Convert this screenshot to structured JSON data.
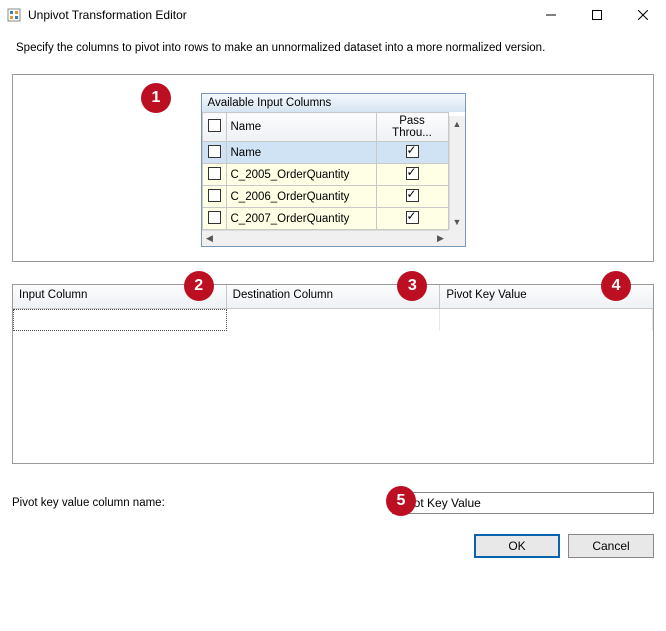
{
  "window": {
    "title": "Unpivot Transformation Editor",
    "subtitle": "Specify the columns to pivot into rows to make an unnormalized dataset into a more normalized version."
  },
  "input_columns": {
    "title": "Available Input Columns",
    "headers": {
      "name": "Name",
      "pass_through": "Pass Throu..."
    },
    "rows": [
      {
        "name": "Name",
        "selected": false,
        "pass_through": true,
        "highlighted": true
      },
      {
        "name": "C_2005_OrderQuantity",
        "selected": false,
        "pass_through": true,
        "highlighted": false
      },
      {
        "name": "C_2006_OrderQuantity",
        "selected": false,
        "pass_through": true,
        "highlighted": false
      },
      {
        "name": "C_2007_OrderQuantity",
        "selected": false,
        "pass_through": true,
        "highlighted": false
      }
    ]
  },
  "mapping_grid": {
    "headers": {
      "input_column": "Input Column",
      "destination_column": "Destination Column",
      "pivot_key_value": "Pivot Key Value"
    }
  },
  "pivot_key": {
    "label": "Pivot key value column name:",
    "value": "Pivot Key Value"
  },
  "buttons": {
    "ok": "OK",
    "cancel": "Cancel"
  },
  "annotations": {
    "a1": "1",
    "a2": "2",
    "a3": "3",
    "a4": "4",
    "a5": "5"
  }
}
